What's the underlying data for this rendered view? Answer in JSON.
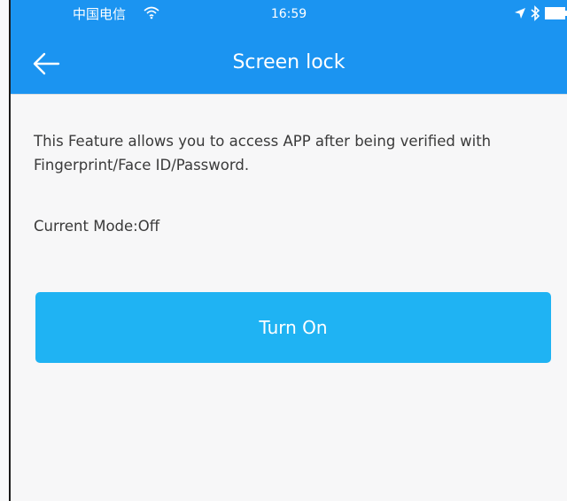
{
  "status_bar": {
    "carrier": "中国电信",
    "time": "16:59",
    "icons": [
      "wifi-icon",
      "location-icon",
      "bluetooth-icon",
      "battery-icon"
    ]
  },
  "nav": {
    "back_icon": "arrow-left-icon",
    "title": "Screen lock"
  },
  "content": {
    "description": "This Feature allows you to access APP after being verified with Fingerprint/Face ID/Password.",
    "mode_label": "Current Mode:",
    "mode_value": "Off",
    "button_label": "Turn On"
  },
  "colors": {
    "header": "#1b94f1",
    "button": "#1fb3f3",
    "background": "#f7f7f8",
    "text": "#3a3a3a"
  }
}
